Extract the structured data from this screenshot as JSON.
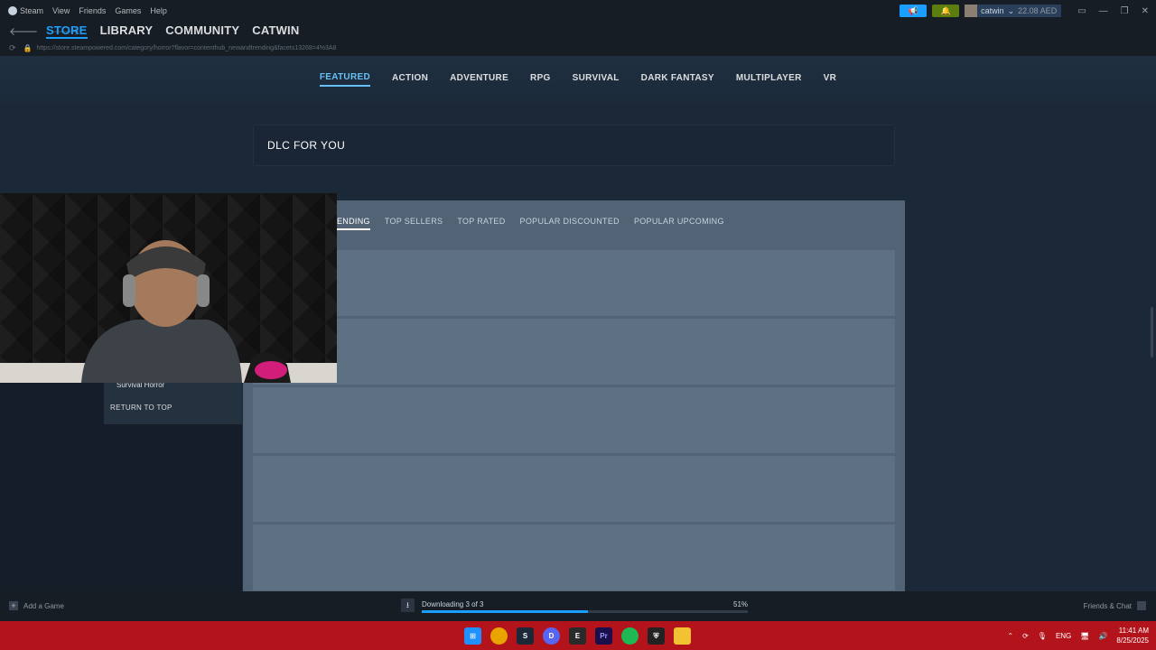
{
  "titlebar": {
    "menu": [
      "Steam",
      "View",
      "Friends",
      "Games",
      "Help"
    ],
    "username": "catwin",
    "balance": "22.08 AED"
  },
  "nav": {
    "tabs": [
      "STORE",
      "LIBRARY",
      "COMMUNITY",
      "CATWIN"
    ],
    "active_tab": "STORE"
  },
  "url": "https://store.steampowered.com/category/horror?flavor=contenthub_newandtrending&facets13268=4%3A8",
  "genres": [
    "FEATURED",
    "ACTION",
    "ADVENTURE",
    "RPG",
    "SURVIVAL",
    "DARK FANTASY",
    "MULTIPLAYER",
    "VR"
  ],
  "dlc_title": "DLC FOR YOU",
  "browse_tabs": [
    "ENDING",
    "TOP SELLERS",
    "TOP RATED",
    "POPULAR DISCOUNTED",
    "POPULAR UPCOMING"
  ],
  "side": {
    "subcategory": "Survival Horror",
    "return_top": "RETURN TO TOP"
  },
  "bottombar": {
    "add_game": "Add a Game",
    "download_status": "Downloading 3 of 3",
    "download_percent_text": "51%",
    "download_progress": 0.51,
    "friends_chat": "Friends & Chat"
  },
  "taskbar": {
    "language": "ENG",
    "time": "11:41 AM",
    "date": "8/25/2025"
  },
  "colors": {
    "accent": "#1a9fff",
    "store_bg": "#1b2838",
    "taskbar": "#b3141b"
  }
}
